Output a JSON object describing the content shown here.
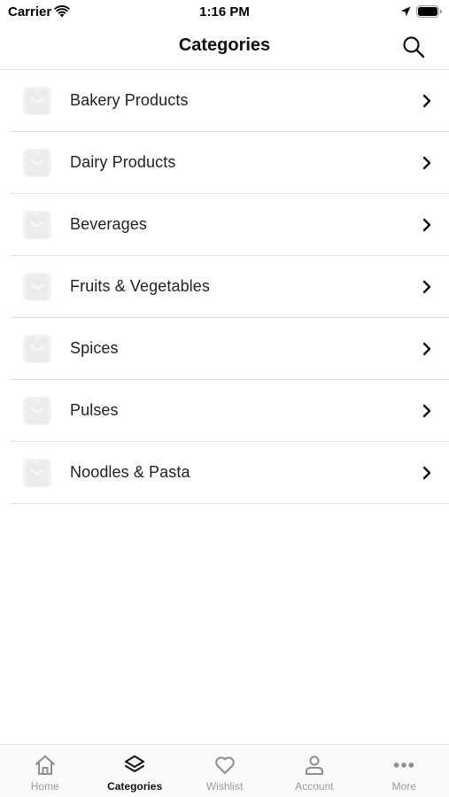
{
  "status_bar": {
    "carrier": "Carrier",
    "time": "1:16 PM"
  },
  "nav": {
    "title": "Categories",
    "search_icon": "search-icon"
  },
  "categories": [
    {
      "label": "Bakery Products",
      "icon": "category-thumbnail"
    },
    {
      "label": "Dairy Products",
      "icon": "category-thumbnail"
    },
    {
      "label": "Beverages",
      "icon": "category-thumbnail"
    },
    {
      "label": "Fruits & Vegetables",
      "icon": "category-thumbnail"
    },
    {
      "label": "Spices",
      "icon": "category-thumbnail"
    },
    {
      "label": "Pulses",
      "icon": "category-thumbnail"
    },
    {
      "label": "Noodles & Pasta",
      "icon": "category-thumbnail"
    }
  ],
  "tab_bar": {
    "items": [
      {
        "label": "Home",
        "icon": "home-icon",
        "active": false
      },
      {
        "label": "Categories",
        "icon": "layers-icon",
        "active": true
      },
      {
        "label": "Wishlist",
        "icon": "heart-icon",
        "active": false
      },
      {
        "label": "Account",
        "icon": "user-icon",
        "active": false
      },
      {
        "label": "More",
        "icon": "more-icon",
        "active": false
      }
    ]
  },
  "colors": {
    "active_tab": "#111111",
    "inactive_tab": "#9a9a9a",
    "divider": "#e1e1e1",
    "thumb_bg": "#f2f2f3"
  }
}
